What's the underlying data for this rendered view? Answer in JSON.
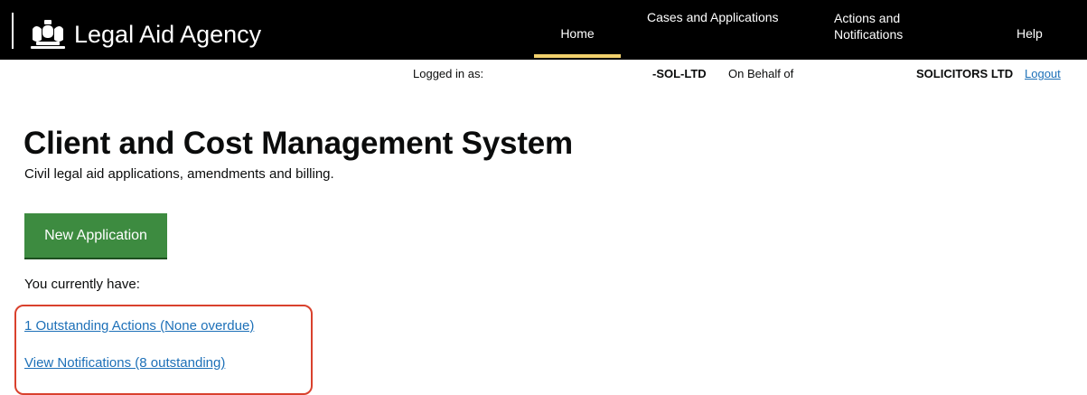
{
  "header": {
    "brand_name": "Legal Aid Agency",
    "nav": {
      "home": "Home",
      "cases": "Cases and Applications",
      "actions_line1": "Actions and",
      "actions_line2": "Notifications",
      "help": "Help"
    },
    "icons": {
      "crest": "royal-crest-icon"
    }
  },
  "session": {
    "logged_in_label": "Logged in as:",
    "user": "-SOL-LTD",
    "on_behalf_label": "On Behalf of",
    "firm": "SOLICITORS LTD",
    "logout": "Logout"
  },
  "main": {
    "title": "Client and Cost Management System",
    "subtitle": "Civil legal aid applications, amendments and billing.",
    "new_application": "New Application",
    "current_label": "You currently have:",
    "actions_link": "1 Outstanding Actions (None overdue)",
    "notifications_link": "View Notifications (8 outstanding)"
  },
  "colors": {
    "header_bg": "#000000",
    "nav_active": "#f2d16c",
    "button_green": "#3d8b40",
    "link_blue": "#1d70b8",
    "highlight_red": "#d9412d"
  }
}
